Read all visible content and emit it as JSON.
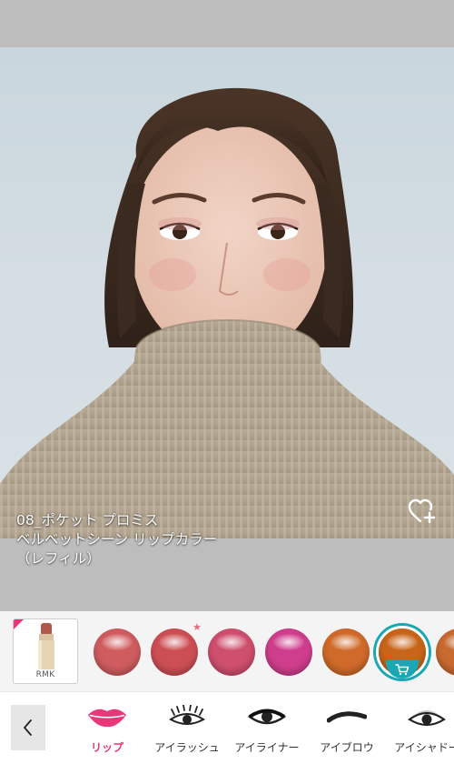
{
  "product": {
    "name_line1": "08_ポケット プロミス",
    "name_line2": "ベルベットシーン リップカラー",
    "name_line3": "（レフィル）",
    "thumb_brand": "RMK"
  },
  "favorite": {
    "icon": "heart-plus-icon"
  },
  "swatches": [
    {
      "color": "#cf5c5f",
      "new": false
    },
    {
      "color": "#cc4f55",
      "new": true
    },
    {
      "color": "#cf4f6e",
      "new": false
    },
    {
      "color": "#cf3e8c",
      "new": false
    },
    {
      "color": "#cf6a2a",
      "new": false
    },
    {
      "color": "#c9651a",
      "selected": true,
      "icon": "cart-icon"
    },
    {
      "color": "#c86a30",
      "new": false
    }
  ],
  "tabs": [
    {
      "label": "リップ",
      "icon": "lips-icon",
      "active": true
    },
    {
      "label": "アイラッシュ",
      "icon": "eyelash-icon"
    },
    {
      "label": "アイライナー",
      "icon": "eyeliner-icon"
    },
    {
      "label": "アイブロウ",
      "icon": "eyebrow-icon"
    },
    {
      "label": "アイシャドー",
      "icon": "eyeshadow-icon"
    }
  ],
  "nav": {
    "back_icon": "chevron-left-icon"
  }
}
